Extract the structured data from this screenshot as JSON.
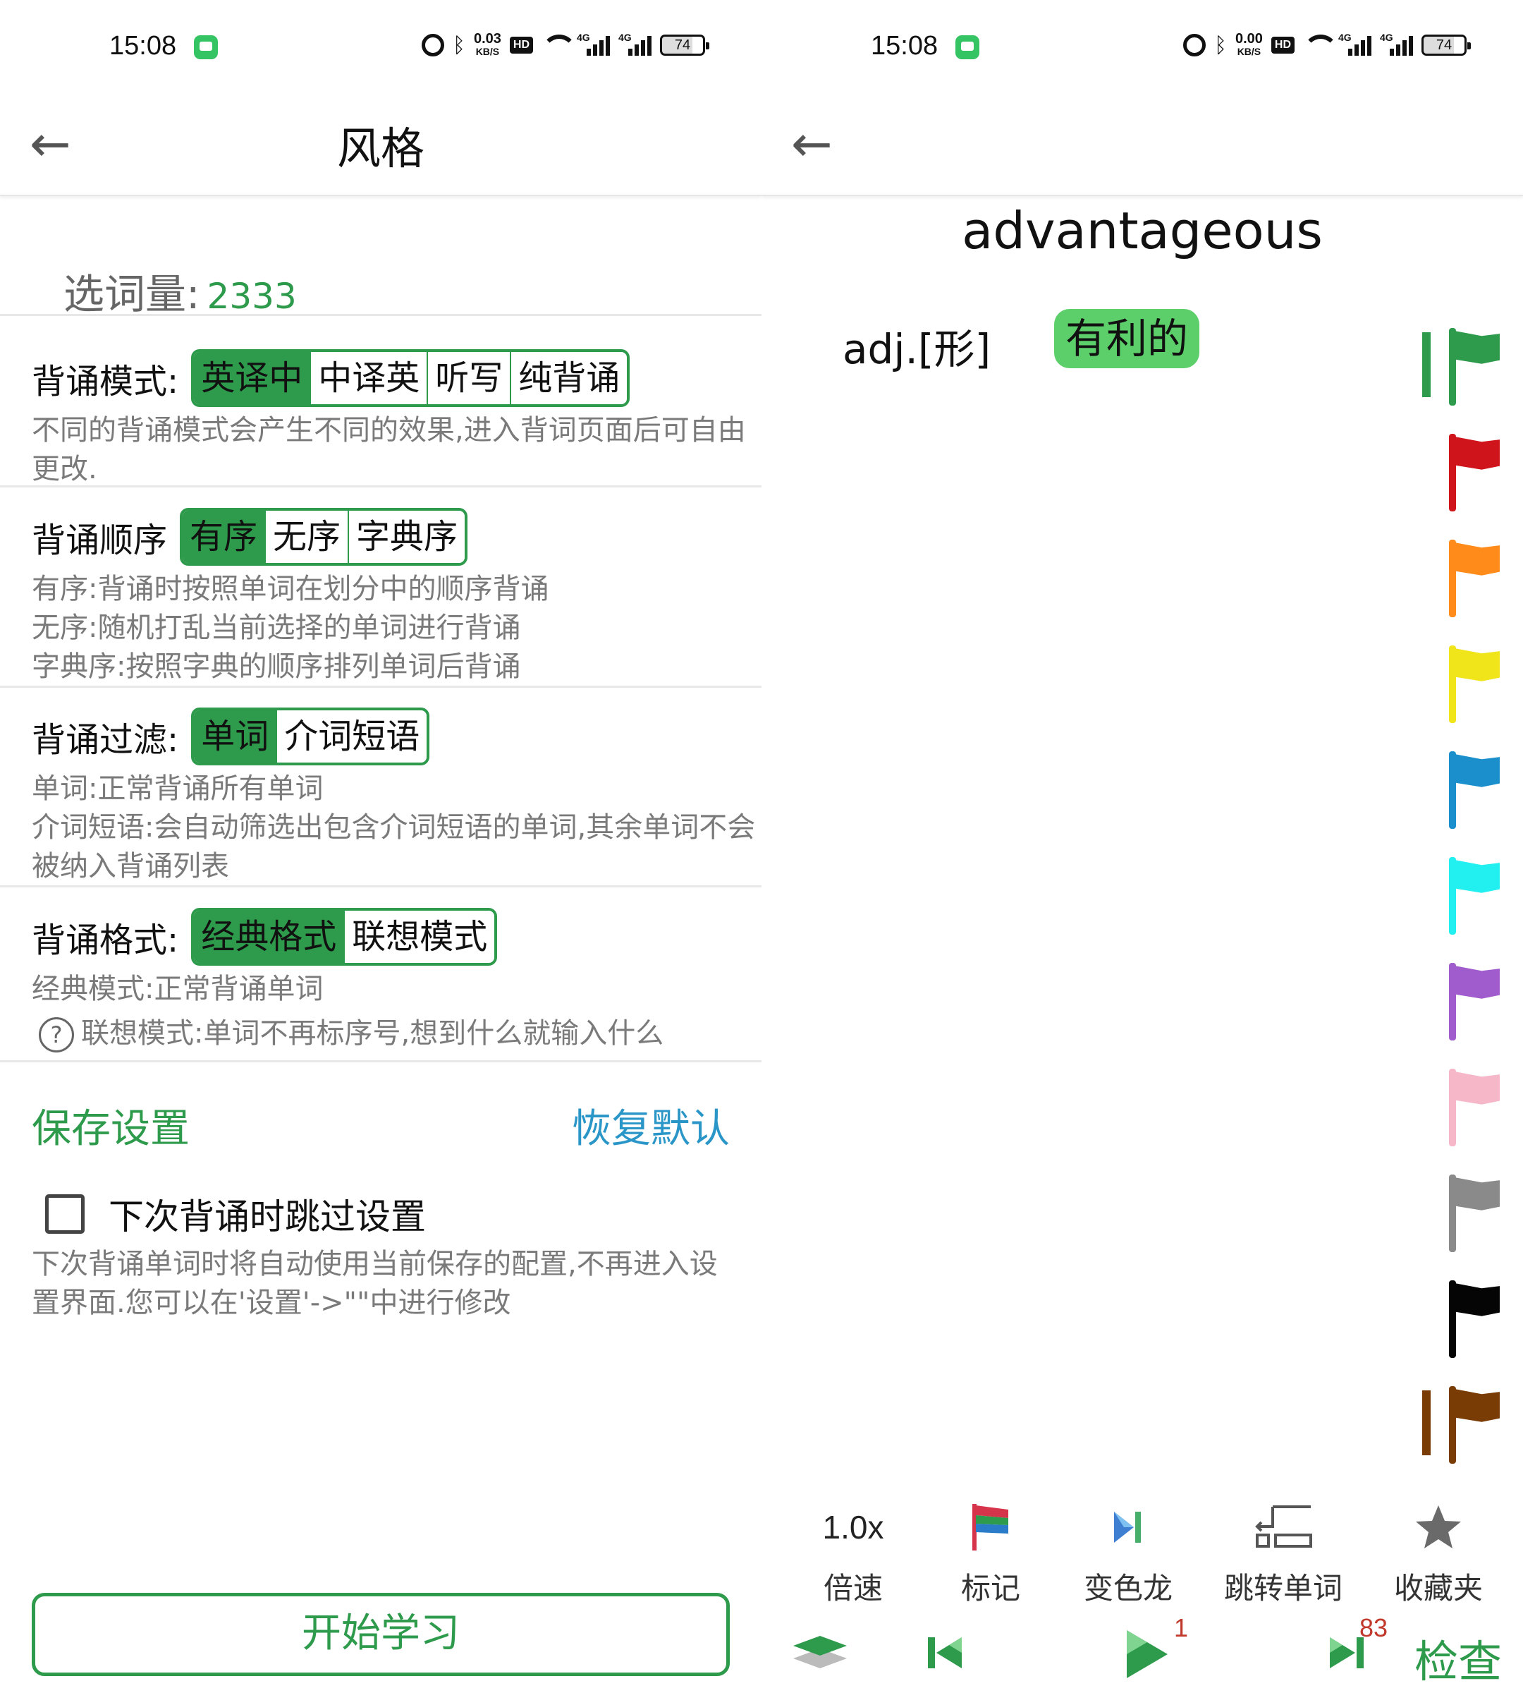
{
  "status_bar": {
    "time": "15:08",
    "left_speed": "0.03",
    "right_speed": "0.00",
    "speed_unit": "KB/S",
    "hd": "HD",
    "net": "4G",
    "battery": "74"
  },
  "left": {
    "title": "风格",
    "word_count_label": "选词量:",
    "word_count_value": "2333",
    "mode": {
      "label": "背诵模式:",
      "options": [
        "英译中",
        "中译英",
        "听写",
        "纯背诵"
      ],
      "selected": "英译中",
      "desc": "不同的背诵模式会产生不同的效果,进入背词页面后可自由更改."
    },
    "order": {
      "label": "背诵顺序",
      "options": [
        "有序",
        "无序",
        "字典序"
      ],
      "selected": "有序",
      "desc": [
        "有序:背诵时按照单词在划分中的顺序背诵",
        "无序:随机打乱当前选择的单词进行背诵",
        "字典序:按照字典的顺序排列单词后背诵"
      ]
    },
    "filter": {
      "label": "背诵过滤:",
      "options": [
        "单词",
        "介词短语"
      ],
      "selected": "单词",
      "desc": [
        "单词:正常背诵所有单词",
        "介词短语:会自动筛选出包含介词短语的单词,其余单词不会被纳入背诵列表"
      ]
    },
    "format": {
      "label": "背诵格式:",
      "options": [
        "经典格式",
        "联想模式"
      ],
      "selected": "经典格式",
      "desc": [
        "经典模式:正常背诵单词",
        "联想模式:单词不再标序号,想到什么就输入什么"
      ],
      "help_icon": "?"
    },
    "save_label": "保存设置",
    "reset_label": "恢复默认",
    "skip_label": "下次背诵时跳过设置",
    "skip_checked": false,
    "skip_desc": "下次背诵单词时将自动使用当前保存的配置,不再进入设置界面.您可以在'设置'->\"\"中进行修改",
    "start_label": "开始学习"
  },
  "right": {
    "word": "advantageous",
    "pos": "adj.[形]",
    "meaning": "有利的",
    "flags": [
      {
        "color": "#2e9a4b",
        "name": "green-flag"
      },
      {
        "color": "#d0141c",
        "name": "red-flag"
      },
      {
        "color": "#ff8c1a",
        "name": "orange-flag"
      },
      {
        "color": "#f0e41a",
        "name": "yellow-flag"
      },
      {
        "color": "#1b8fcb",
        "name": "blue-flag"
      },
      {
        "color": "#22f0f0",
        "name": "cyan-flag"
      },
      {
        "color": "#a05ccc",
        "name": "purple-flag"
      },
      {
        "color": "#f6b8c8",
        "name": "pink-flag"
      },
      {
        "color": "#8a8a8a",
        "name": "gray-flag"
      },
      {
        "color": "#050505",
        "name": "black-flag"
      },
      {
        "color": "#7a3c05",
        "name": "brown-flag"
      }
    ],
    "tools": [
      {
        "icon": "speed",
        "value": "1.0x",
        "label": "倍速"
      },
      {
        "icon": "flag-icon",
        "label": "标记"
      },
      {
        "icon": "chameleon-icon",
        "label": "变色龙"
      },
      {
        "icon": "jump-icon",
        "label": "跳转单词"
      },
      {
        "icon": "star-icon",
        "label": "收藏夹"
      }
    ],
    "play_badge": "1",
    "next_badge": "83",
    "check_label": "检查",
    "accent": "#2e9a4b"
  }
}
